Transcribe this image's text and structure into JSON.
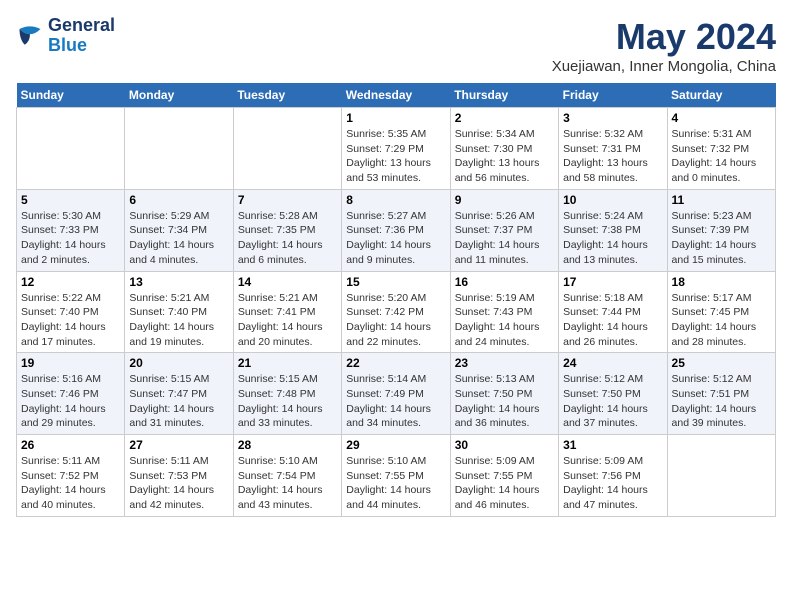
{
  "header": {
    "logo_general": "General",
    "logo_blue": "Blue",
    "month": "May 2024",
    "location": "Xuejiawan, Inner Mongolia, China"
  },
  "weekdays": [
    "Sunday",
    "Monday",
    "Tuesday",
    "Wednesday",
    "Thursday",
    "Friday",
    "Saturday"
  ],
  "weeks": [
    [
      {
        "day": "",
        "info": ""
      },
      {
        "day": "",
        "info": ""
      },
      {
        "day": "",
        "info": ""
      },
      {
        "day": "1",
        "info": "Sunrise: 5:35 AM\nSunset: 7:29 PM\nDaylight: 13 hours and 53 minutes."
      },
      {
        "day": "2",
        "info": "Sunrise: 5:34 AM\nSunset: 7:30 PM\nDaylight: 13 hours and 56 minutes."
      },
      {
        "day": "3",
        "info": "Sunrise: 5:32 AM\nSunset: 7:31 PM\nDaylight: 13 hours and 58 minutes."
      },
      {
        "day": "4",
        "info": "Sunrise: 5:31 AM\nSunset: 7:32 PM\nDaylight: 14 hours and 0 minutes."
      }
    ],
    [
      {
        "day": "5",
        "info": "Sunrise: 5:30 AM\nSunset: 7:33 PM\nDaylight: 14 hours and 2 minutes."
      },
      {
        "day": "6",
        "info": "Sunrise: 5:29 AM\nSunset: 7:34 PM\nDaylight: 14 hours and 4 minutes."
      },
      {
        "day": "7",
        "info": "Sunrise: 5:28 AM\nSunset: 7:35 PM\nDaylight: 14 hours and 6 minutes."
      },
      {
        "day": "8",
        "info": "Sunrise: 5:27 AM\nSunset: 7:36 PM\nDaylight: 14 hours and 9 minutes."
      },
      {
        "day": "9",
        "info": "Sunrise: 5:26 AM\nSunset: 7:37 PM\nDaylight: 14 hours and 11 minutes."
      },
      {
        "day": "10",
        "info": "Sunrise: 5:24 AM\nSunset: 7:38 PM\nDaylight: 14 hours and 13 minutes."
      },
      {
        "day": "11",
        "info": "Sunrise: 5:23 AM\nSunset: 7:39 PM\nDaylight: 14 hours and 15 minutes."
      }
    ],
    [
      {
        "day": "12",
        "info": "Sunrise: 5:22 AM\nSunset: 7:40 PM\nDaylight: 14 hours and 17 minutes."
      },
      {
        "day": "13",
        "info": "Sunrise: 5:21 AM\nSunset: 7:40 PM\nDaylight: 14 hours and 19 minutes."
      },
      {
        "day": "14",
        "info": "Sunrise: 5:21 AM\nSunset: 7:41 PM\nDaylight: 14 hours and 20 minutes."
      },
      {
        "day": "15",
        "info": "Sunrise: 5:20 AM\nSunset: 7:42 PM\nDaylight: 14 hours and 22 minutes."
      },
      {
        "day": "16",
        "info": "Sunrise: 5:19 AM\nSunset: 7:43 PM\nDaylight: 14 hours and 24 minutes."
      },
      {
        "day": "17",
        "info": "Sunrise: 5:18 AM\nSunset: 7:44 PM\nDaylight: 14 hours and 26 minutes."
      },
      {
        "day": "18",
        "info": "Sunrise: 5:17 AM\nSunset: 7:45 PM\nDaylight: 14 hours and 28 minutes."
      }
    ],
    [
      {
        "day": "19",
        "info": "Sunrise: 5:16 AM\nSunset: 7:46 PM\nDaylight: 14 hours and 29 minutes."
      },
      {
        "day": "20",
        "info": "Sunrise: 5:15 AM\nSunset: 7:47 PM\nDaylight: 14 hours and 31 minutes."
      },
      {
        "day": "21",
        "info": "Sunrise: 5:15 AM\nSunset: 7:48 PM\nDaylight: 14 hours and 33 minutes."
      },
      {
        "day": "22",
        "info": "Sunrise: 5:14 AM\nSunset: 7:49 PM\nDaylight: 14 hours and 34 minutes."
      },
      {
        "day": "23",
        "info": "Sunrise: 5:13 AM\nSunset: 7:50 PM\nDaylight: 14 hours and 36 minutes."
      },
      {
        "day": "24",
        "info": "Sunrise: 5:12 AM\nSunset: 7:50 PM\nDaylight: 14 hours and 37 minutes."
      },
      {
        "day": "25",
        "info": "Sunrise: 5:12 AM\nSunset: 7:51 PM\nDaylight: 14 hours and 39 minutes."
      }
    ],
    [
      {
        "day": "26",
        "info": "Sunrise: 5:11 AM\nSunset: 7:52 PM\nDaylight: 14 hours and 40 minutes."
      },
      {
        "day": "27",
        "info": "Sunrise: 5:11 AM\nSunset: 7:53 PM\nDaylight: 14 hours and 42 minutes."
      },
      {
        "day": "28",
        "info": "Sunrise: 5:10 AM\nSunset: 7:54 PM\nDaylight: 14 hours and 43 minutes."
      },
      {
        "day": "29",
        "info": "Sunrise: 5:10 AM\nSunset: 7:55 PM\nDaylight: 14 hours and 44 minutes."
      },
      {
        "day": "30",
        "info": "Sunrise: 5:09 AM\nSunset: 7:55 PM\nDaylight: 14 hours and 46 minutes."
      },
      {
        "day": "31",
        "info": "Sunrise: 5:09 AM\nSunset: 7:56 PM\nDaylight: 14 hours and 47 minutes."
      },
      {
        "day": "",
        "info": ""
      }
    ]
  ]
}
